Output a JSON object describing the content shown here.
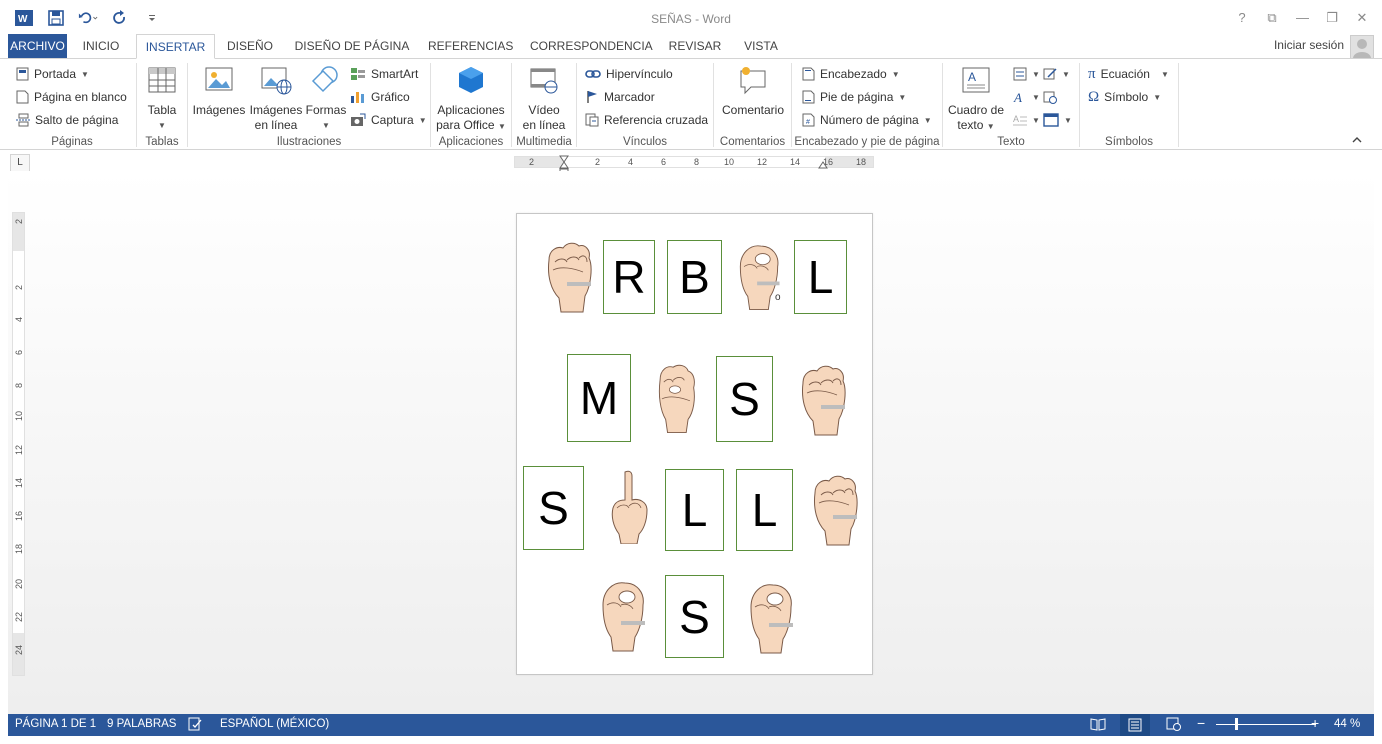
{
  "window": {
    "title": "SEÑAS - Word",
    "controls": {
      "help": "?",
      "ribbon_display": "⧉",
      "minimize": "—",
      "restore": "❐",
      "close": "✕"
    }
  },
  "tabs": {
    "file": "ARCHIVO",
    "items": [
      "INICIO",
      "INSERTAR",
      "DISEÑO",
      "DISEÑO DE PÁGINA",
      "REFERENCIAS",
      "CORRESPONDENCIA",
      "REVISAR",
      "VISTA"
    ],
    "active": "INSERTAR",
    "signin": "Iniciar sesión"
  },
  "ribbon": {
    "paginas": {
      "portada": "Portada",
      "pagina_en_blanco": "Página en blanco",
      "salto_de_pagina": "Salto de página",
      "label": "Páginas"
    },
    "tablas": {
      "tabla": "Tabla",
      "label": "Tablas"
    },
    "ilustraciones": {
      "imagenes": "Imágenes",
      "imagenes_en_linea_1": "Imágenes",
      "imagenes_en_linea_2": "en línea",
      "formas": "Formas",
      "smartart": "SmartArt",
      "grafico": "Gráfico",
      "captura": "Captura",
      "label": "Ilustraciones"
    },
    "aplicaciones": {
      "line1": "Aplicaciones",
      "line2": "para Office",
      "label": "Aplicaciones"
    },
    "multimedia": {
      "line1": "Vídeo",
      "line2": "en línea",
      "label": "Multimedia"
    },
    "vinculos": {
      "hipervinculo": "Hipervínculo",
      "marcador": "Marcador",
      "referencia_cruzada": "Referencia cruzada",
      "label": "Vínculos"
    },
    "comentarios": {
      "comentario": "Comentario",
      "label": "Comentarios"
    },
    "encabezado": {
      "encabezado": "Encabezado",
      "pie_de_pagina": "Pie de página",
      "numero_de_pagina": "Número de página",
      "label": "Encabezado y pie de página"
    },
    "texto": {
      "cuadro_1": "Cuadro de",
      "cuadro_2": "texto",
      "label": "Texto"
    },
    "simbolos": {
      "ecuacion": "Ecuación",
      "simbolo": "Símbolo",
      "label": "Símbolos"
    }
  },
  "ruler": {
    "corner": "L",
    "horizontal_ticks": [
      "2",
      "2",
      "4",
      "6",
      "8",
      "10",
      "12",
      "14",
      "16",
      "18"
    ],
    "vertical_ticks": [
      "2",
      "2",
      "4",
      "6",
      "8",
      "10",
      "12",
      "14",
      "16",
      "18",
      "20",
      "22",
      "24"
    ]
  },
  "document": {
    "cards": [
      {
        "letter": "R"
      },
      {
        "letter": "B"
      },
      {
        "letter": "L"
      },
      {
        "letter": "M"
      },
      {
        "letter": "S"
      },
      {
        "letter": "S"
      },
      {
        "letter": "L"
      },
      {
        "letter": "L"
      },
      {
        "letter": "S"
      }
    ],
    "hand_labels": [
      "o"
    ]
  },
  "status": {
    "page": "PÁGINA 1 DE 1",
    "words": "9 PALABRAS",
    "language": "ESPAÑOL (MÉXICO)",
    "zoom": "44 %",
    "zoom_minus": "−",
    "zoom_plus": "+"
  },
  "colors": {
    "accent": "#2b579a",
    "card_border": "#5a8f3a",
    "skin": "#f6d7bd"
  }
}
